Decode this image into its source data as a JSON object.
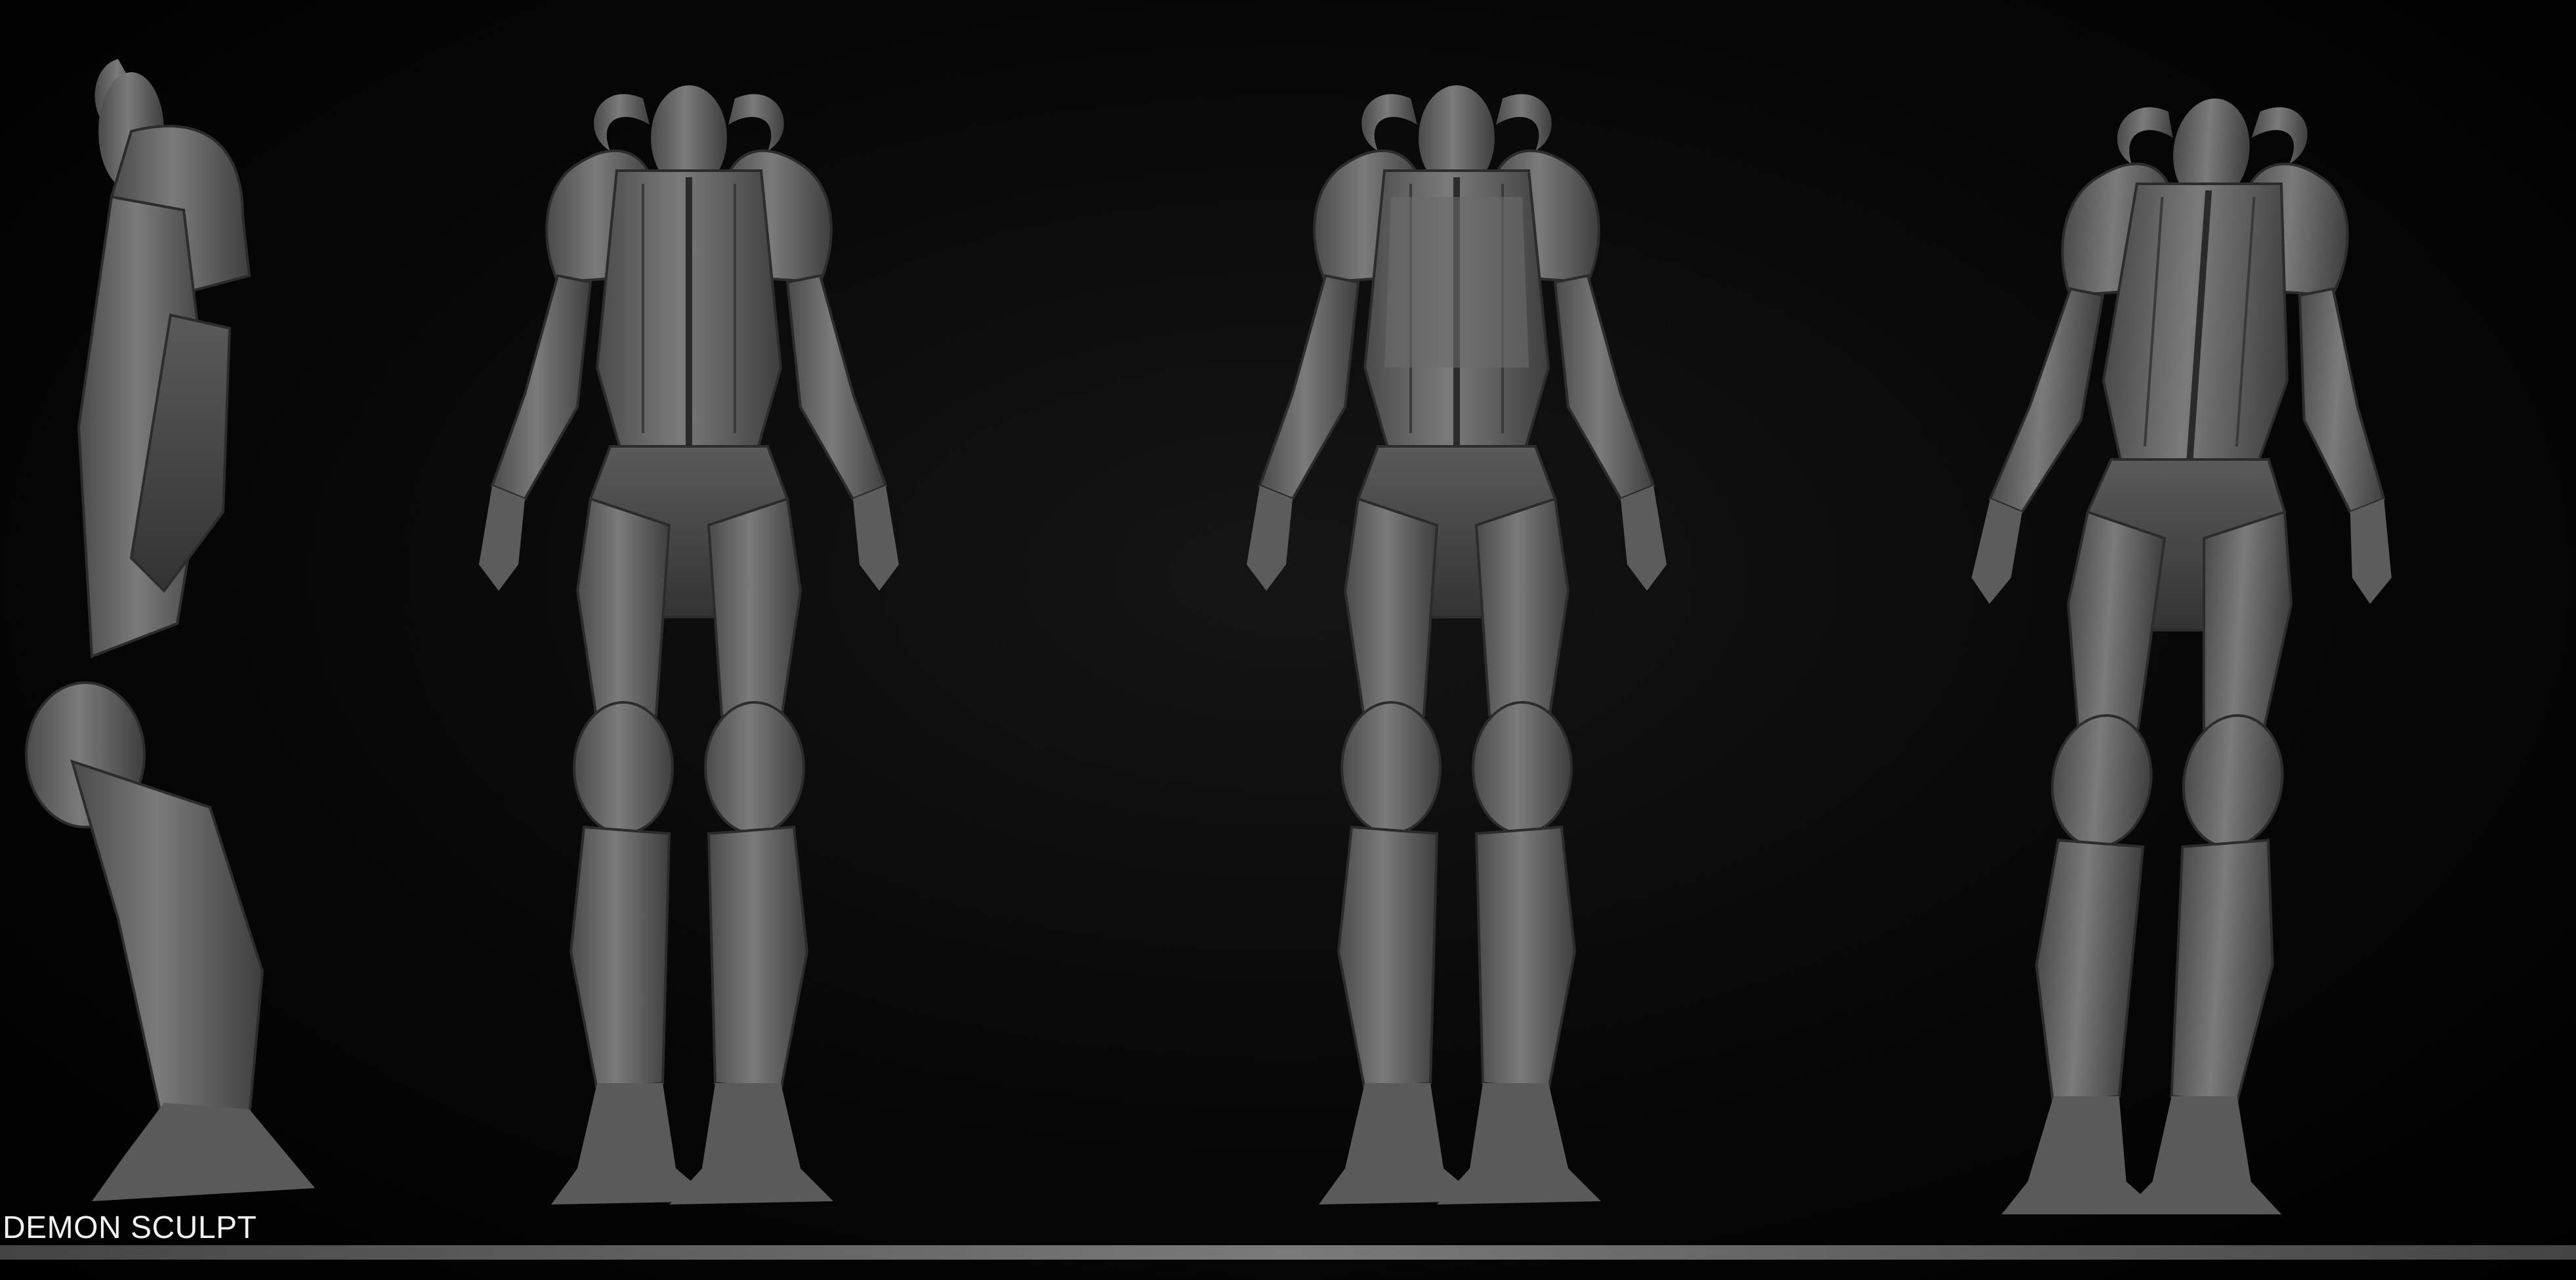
{
  "caption": "DEMON SCULPT",
  "views": [
    {
      "name": "side-view"
    },
    {
      "name": "front-view"
    },
    {
      "name": "back-view"
    },
    {
      "name": "three-quarter-view"
    }
  ],
  "colors": {
    "background": "#000000",
    "sculpt_clay": "#6e6e6e",
    "sculpt_shadow": "#3a3a3a",
    "caption_text": "#f2f2f2",
    "baseline_bar": "#6a6a6a"
  }
}
